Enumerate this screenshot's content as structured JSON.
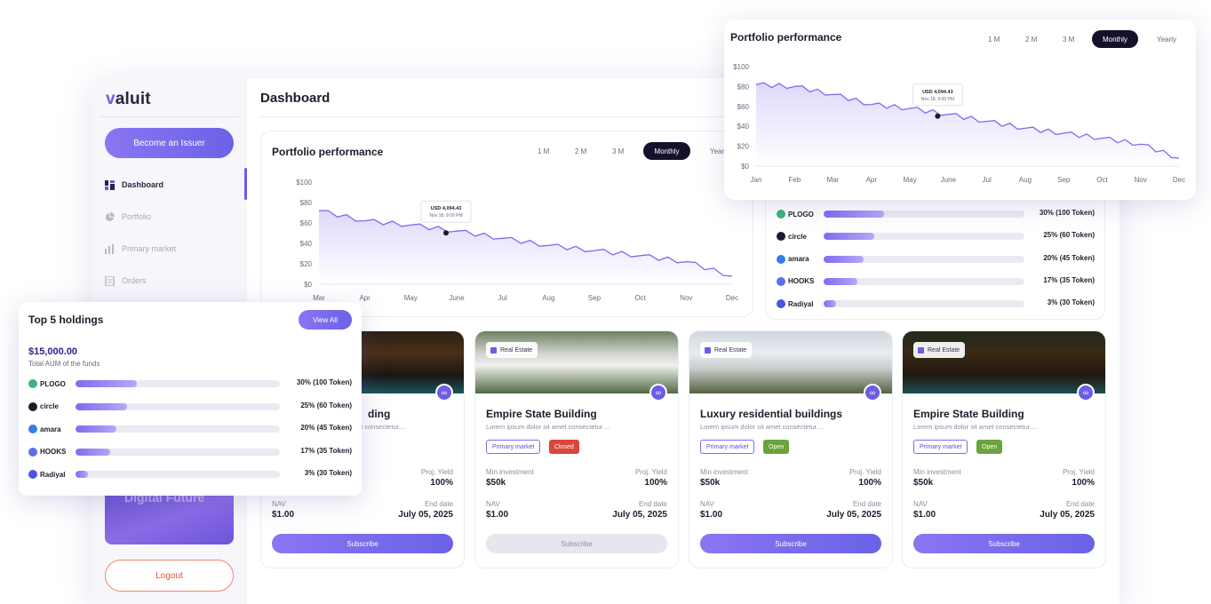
{
  "app": {
    "brand": "valuit",
    "sidebar": {
      "become_issuer": "Become an Issuer",
      "items": [
        {
          "label": "Dashboard",
          "icon": "dashboard-icon",
          "active": true
        },
        {
          "label": "Portfolio",
          "icon": "pie-chart-icon"
        },
        {
          "label": "Primary market",
          "icon": "bar-chart-icon"
        },
        {
          "label": "Orders",
          "icon": "orders-icon"
        }
      ],
      "promo_text": "Digital Future",
      "logout": "Logout"
    },
    "page_title": "Dashboard",
    "chart_card": {
      "title": "Portfolio performance",
      "periods": [
        "1 M",
        "2 M",
        "3 M",
        "Monthly",
        "Yearly"
      ],
      "selected_period": "Monthly",
      "tooltip_value": "USD 4,094.43",
      "tooltip_date": "Nov 18, 9:00 PM"
    }
  },
  "assets": [
    {
      "tag": "Real Estate",
      "name": "Empire State Building",
      "desc": "Lorem ipsum dolor sit amet consectetur....",
      "badges": [
        "Primary market",
        "Closed"
      ],
      "min_inv_label": "Min investment",
      "min_inv": "$50k",
      "yield_label": "Proj. Yield",
      "yield": "100%",
      "nav_label": "NAV",
      "nav": "$1.00",
      "end_label": "End date",
      "end": "July 05, 2025",
      "subscribe": "Subscribe"
    },
    {
      "tag": "Real Estate",
      "name": "Luxury residential buildings",
      "desc": "Lorem ipsum dolor sit amet consectetur....",
      "badges": [
        "Primary market",
        "Open"
      ],
      "min_inv_label": "Min investment",
      "min_inv": "$50k",
      "yield_label": "Proj. Yield",
      "yield": "100%",
      "nav_label": "NAV",
      "nav": "$1.00",
      "end_label": "End date",
      "end": "July 05, 2025",
      "subscribe": "Subscribe"
    },
    {
      "tag": "Real Estate",
      "name": "Empire State Building",
      "desc": "Lorem ipsum dolor sit amet consectetur....",
      "badges": [
        "Primary market",
        "Open"
      ],
      "min_inv_label": "Min investment",
      "min_inv": "$50k",
      "yield_label": "Proj. Yield",
      "yield": "100%",
      "nav_label": "NAV",
      "nav": "$1.00",
      "end_label": "End date",
      "end": "July 05, 2025",
      "subscribe": "Subscribe"
    }
  ],
  "partial_asset": {
    "name_fragment": "ding",
    "desc_fragment": "et consectetur....",
    "yield_label": "Proj. Yield",
    "yield": "100%",
    "nav_label": "NAV",
    "nav": "$1.00",
    "end_label": "End date",
    "end": "July 05, 2025",
    "subscribe": "Subscribe"
  },
  "float_chart": {
    "title": "Portfolio performance",
    "periods": [
      "1 M",
      "2 M",
      "3 M",
      "Monthly",
      "Yearly"
    ],
    "selected_period": "Monthly",
    "tooltip_value": "USD 4,094.43",
    "tooltip_date": "Nov 18, 9:00 PM"
  },
  "top_holdings": {
    "title": "Top 5 holdings",
    "view_all": "View All",
    "amount": "$15,000.00",
    "amount_label": "Total AUM of the funds",
    "items": [
      {
        "name": "PLOGO",
        "pct_label": "30% (100 Token)",
        "pct": 30,
        "color": "#3bb37a"
      },
      {
        "name": "circle",
        "pct_label": "25% (60 Token)",
        "pct": 25,
        "color": "#1c1c2b"
      },
      {
        "name": "amara",
        "pct_label": "20% (45 Token)",
        "pct": 20,
        "color": "#3a7bea"
      },
      {
        "name": "HOOKS",
        "pct_label": "17% (35 Token)",
        "pct": 17,
        "color": "#5c6ee8"
      },
      {
        "name": "Radiyal",
        "pct_label": "3% (30 Token)",
        "pct": 3,
        "color": "#4a55e0"
      }
    ]
  },
  "chart_data": [
    {
      "type": "area",
      "x": [
        "Jan",
        "Feb",
        "Mar",
        "Apr",
        "May",
        "June",
        "Jul",
        "Aug",
        "Sep",
        "Oct",
        "Nov",
        "Dec"
      ],
      "series": [
        {
          "values": [
            82,
            80,
            72,
            62,
            58,
            52,
            45,
            38,
            33,
            28,
            22,
            8
          ]
        }
      ],
      "ylim": [
        0,
        100
      ],
      "yticks": [
        "$0",
        "$20",
        "$40",
        "$60",
        "$80",
        "$100"
      ],
      "grid": false,
      "annotation": {
        "label": "USD 4,094.43",
        "sublabel": "Nov 18, 9:00 PM"
      }
    },
    {
      "type": "area",
      "x": [
        "Mar",
        "Apr",
        "May",
        "June",
        "Jul",
        "Aug",
        "Sep",
        "Oct",
        "Nov",
        "Dec"
      ],
      "series": [
        {
          "values": [
            72,
            62,
            58,
            52,
            45,
            38,
            33,
            28,
            22,
            8
          ]
        }
      ],
      "ylim": [
        0,
        100
      ],
      "yticks": [
        "$0",
        "$20",
        "$40",
        "$60",
        "$80",
        "$100"
      ],
      "grid": false,
      "annotation": {
        "label": "USD 4,094.43",
        "sublabel": "Nov 18, 9:00 PM"
      }
    }
  ],
  "colors": {
    "accent": "#6d5ce8",
    "dark": "#14112a",
    "closed": "#d9463c",
    "open": "#6ba33c",
    "logout": "#e2553f"
  }
}
